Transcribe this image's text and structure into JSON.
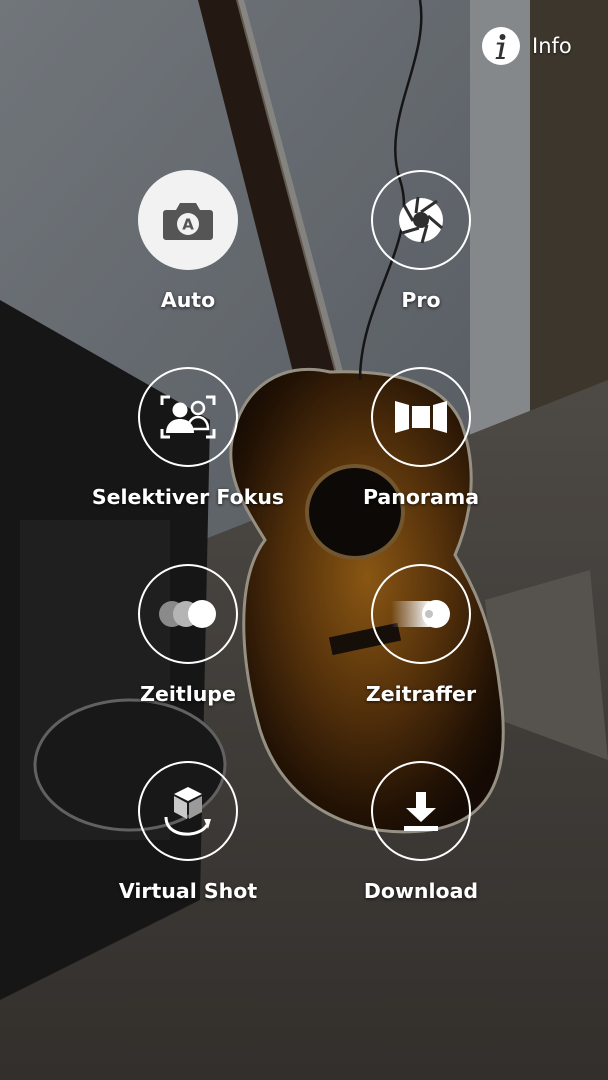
{
  "header": {
    "info_label": "Info",
    "info_icon": "info-icon"
  },
  "modes": [
    {
      "label": "Auto",
      "icon": "camera-auto-icon",
      "selected": true
    },
    {
      "label": "Pro",
      "icon": "aperture-icon",
      "selected": false
    },
    {
      "label": "Selektiver Fokus",
      "icon": "selective-focus-icon",
      "selected": false
    },
    {
      "label": "Panorama",
      "icon": "panorama-icon",
      "selected": false
    },
    {
      "label": "Zeitlupe",
      "icon": "slow-motion-icon",
      "selected": false
    },
    {
      "label": "Zeitraffer",
      "icon": "hyperlapse-icon",
      "selected": false
    },
    {
      "label": "Virtual Shot",
      "icon": "virtual-shot-icon",
      "selected": false
    },
    {
      "label": "Download",
      "icon": "download-icon",
      "selected": false
    }
  ],
  "colors": {
    "icon_white": "#ffffff",
    "selected_fill": "#f2f2f2",
    "selected_icon": "#555555"
  }
}
